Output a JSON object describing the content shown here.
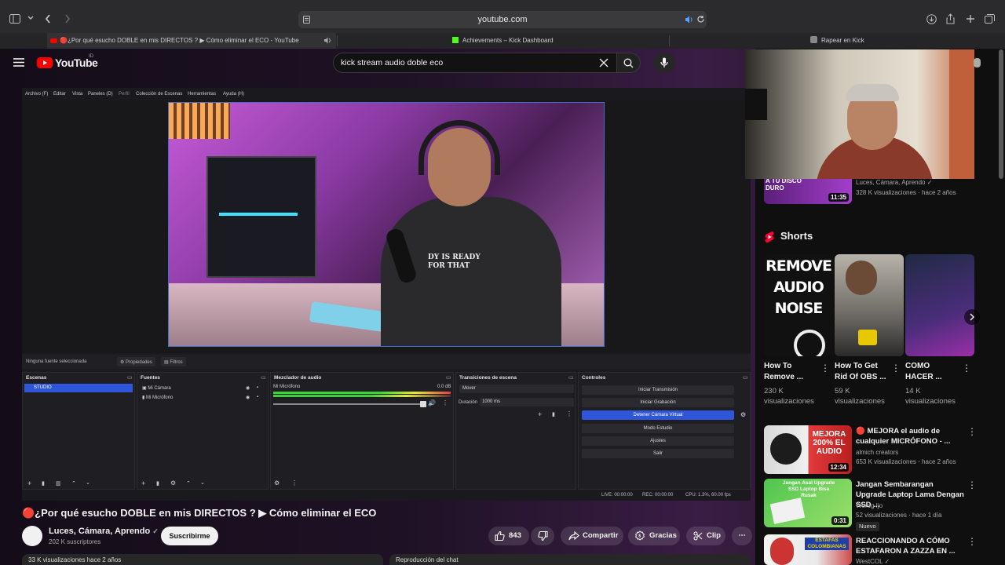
{
  "browser": {
    "address": "youtube.com",
    "tabs": [
      {
        "label": "🔴¿Por qué esucho DOBLE en mis DIRECTOS ? ▶ Cómo eliminar el ECO - YouTube"
      },
      {
        "label": "Achievements – Kick Dashboard"
      },
      {
        "label": "Rapear en Kick"
      }
    ]
  },
  "youtube": {
    "logo_text": "YouTube",
    "logo_country": "ID",
    "search_value": "kick stream audio doble eco"
  },
  "obs": {
    "menu": [
      "Archivo (F)",
      "Editar",
      "Vista",
      "Paneles (D)",
      "Perfil",
      "Colección de Escenas",
      "Herramientas",
      "Ayuda (H)"
    ],
    "status_left": "Ninguna fuente seleccionada",
    "props_btn": "Propiedades",
    "filters_btn": "Filtros",
    "shirt_text": "DY IS READY FOR THAT",
    "docks": {
      "scenes": {
        "title": "Escenas",
        "items": [
          "STUDIO"
        ]
      },
      "sources": {
        "title": "Fuentes",
        "items": [
          "Mi Cámara",
          "Mi Micrófono"
        ]
      },
      "mixer": {
        "title": "Mezclador de audio",
        "track": "Mi Micrófono",
        "db": "0.0 dB"
      },
      "transitions": {
        "title": "Transiciones de escena",
        "type": "Mover",
        "duration_label": "Duración",
        "duration_value": "1000 ms"
      },
      "controls": {
        "title": "Controles",
        "buttons": [
          "Iniciar Transmisión",
          "Iniciar Grabación",
          "Detener Cámara Virtual",
          "Modo Estudio",
          "Ajustes",
          "Salir"
        ]
      }
    },
    "footer": {
      "live": "LIVE: 00:00:00",
      "rec": "REC: 00:00:00",
      "cpu": "CPU: 1.3%, 60.00 fps"
    }
  },
  "video": {
    "title": "🔴¿Por qué esucho DOBLE en mis DIRECTOS ? ▶ Cómo eliminar el ECO",
    "channel": "Luces, Cámara, Aprendo",
    "subscribers": "202 K suscriptores",
    "subscribe_label": "Suscribirme",
    "likes": "843",
    "share_label": "Compartir",
    "thanks_label": "Gracias",
    "clip_label": "Clip",
    "views_strip": "33 K visualizaciones  hace 2 años",
    "chat_strip": "Reproducción del chat"
  },
  "sidebar": {
    "top_item": {
      "thumb_text": "A TU DISCO DURO",
      "duration": "11:35",
      "channel": "Luces, Cámara, Aprendo",
      "meta": "328 K visualizaciones · hace 2 años"
    },
    "shorts_heading": "Shorts",
    "shorts": [
      {
        "title": "How To Remove ...",
        "views": "230 K visualizaciones",
        "thumb_text": "REMOVE AUDIO NOISE"
      },
      {
        "title": "How To Get Rid Of OBS ...",
        "views": "59 K visualizaciones"
      },
      {
        "title": "COMO HACER ...",
        "views": "14 K visualizaciones"
      }
    ],
    "videos": [
      {
        "title": "🔴 MEJORA el audio de cualquier MICRÓFONO - ...",
        "channel": "almich creators",
        "meta": "653 K visualizaciones · hace 2 años",
        "duration": "12:34",
        "thumb_text": "MEJORA 200% EL AUDIO"
      },
      {
        "title": "Jangan Sembarangan Upgrade Laptop Lama Dengan SSD ...",
        "channel": "Werog Ijo",
        "meta": "52 visualizaciones · hace 1 día",
        "badge": "Nuevo",
        "duration": "0:31",
        "thumb_text": "Jangan Asal Upgrade SSD Laptop Bisa Rusak"
      },
      {
        "title": "REACCIONANDO A CÓMO ESTAFARON A ZAZZA EN ...",
        "channel": "WestCOL",
        "thumb_text": "ESTAFAS COLOMBIANAS"
      }
    ]
  }
}
